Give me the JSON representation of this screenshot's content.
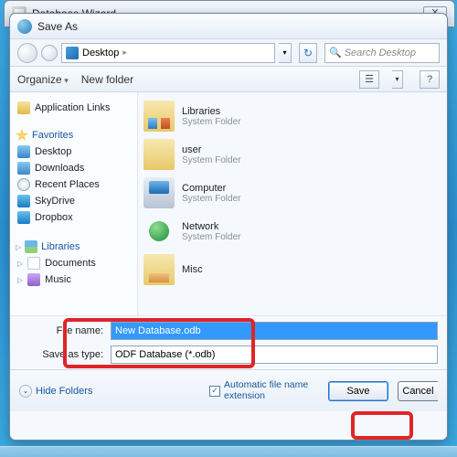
{
  "wizard": {
    "title": "Database Wizard"
  },
  "dialog": {
    "title": "Save As",
    "address": {
      "location": "Desktop",
      "chevron": "▸"
    },
    "search": {
      "placeholder": "Search Desktop"
    },
    "toolbar": {
      "organize": "Organize",
      "newfolder": "New folder",
      "view_glyph": "☰",
      "help_glyph": "?"
    }
  },
  "sidebar": {
    "app_links": "Application Links",
    "favorites": "Favorites",
    "fav_items": [
      {
        "label": "Desktop",
        "icon": "ic-desktop"
      },
      {
        "label": "Downloads",
        "icon": "ic-dl"
      },
      {
        "label": "Recent Places",
        "icon": "ic-clock"
      },
      {
        "label": "SkyDrive",
        "icon": "ic-sky"
      },
      {
        "label": "Dropbox",
        "icon": "ic-drop"
      }
    ],
    "libraries": "Libraries",
    "lib_items": [
      {
        "label": "Documents",
        "icon": "ic-doc"
      },
      {
        "label": "Music",
        "icon": "ic-music"
      }
    ]
  },
  "list": [
    {
      "name": "Libraries",
      "sub": "System Folder",
      "ic": "folders lib"
    },
    {
      "name": "user",
      "sub": "System Folder",
      "ic": "folders"
    },
    {
      "name": "Computer",
      "sub": "System Folder",
      "ic": "comp"
    },
    {
      "name": "Network",
      "sub": "System Folder",
      "ic": "net"
    },
    {
      "name": "Misc",
      "sub": "",
      "ic": "folders misc"
    }
  ],
  "form": {
    "filename_label": "File name:",
    "filename_value": "New Database.odb",
    "type_label": "Save as type:",
    "type_value": "ODF Database (*.odb)"
  },
  "footer": {
    "hide": "Hide Folders",
    "auto_ext": "Automatic file name extension",
    "save": "Save",
    "cancel": "Cancel"
  }
}
